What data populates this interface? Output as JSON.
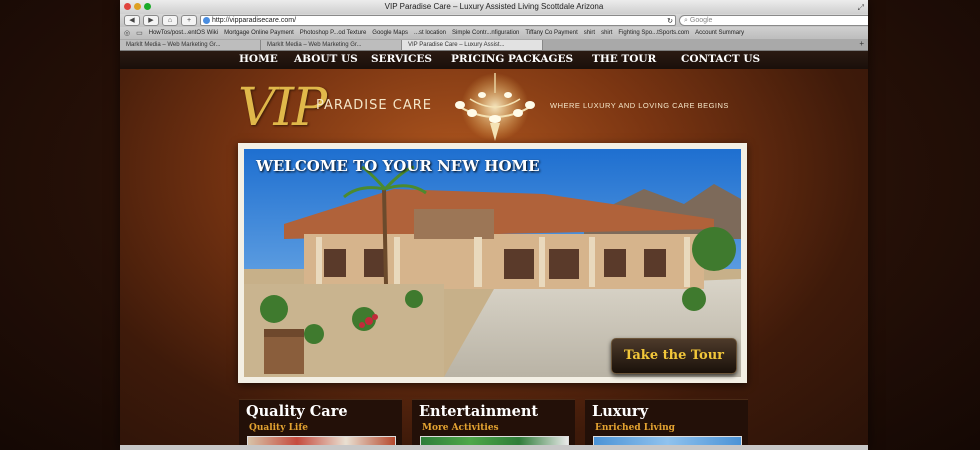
{
  "window": {
    "title": "VIP Paradise Care – Luxury Assisted Living Scottdale Arizona"
  },
  "toolbar": {
    "url": "http://vipparadisecare.com/",
    "search_placeholder": "Google"
  },
  "bookmarks": [
    "HowTos/post...entOS Wiki",
    "Mortgage Online Payment",
    "Photoshop P...od Texture",
    "Google Maps",
    "...st location",
    "Simple Contr...nfiguration",
    "Tiffany Co Payment",
    "shirt",
    "shirt",
    "Fighting Spo...tSports.com",
    "Account Summary"
  ],
  "tabs": [
    "MarkIt Media – Web Marketing Gr...",
    "MarkIt Media – Web Marketing Gr...",
    "VIP Paradise Care – Luxury Assist..."
  ],
  "nav": [
    "HOME",
    "ABOUT US",
    "SERVICES",
    "PRICING PACKAGES",
    "THE TOUR",
    "CONTACT US"
  ],
  "brand": {
    "logo": "VIP",
    "name": "PARADISE CARE",
    "tagline": "WHERE LUXURY AND LOVING CARE BEGINS"
  },
  "hero": {
    "title": "WELCOME TO YOUR NEW HOME",
    "button": "Take the Tour"
  },
  "features": [
    {
      "title": "Quality Care",
      "subtitle": "Quality Life"
    },
    {
      "title": "Entertainment",
      "subtitle": "More Activities"
    },
    {
      "title": "Luxury",
      "subtitle": "Enriched Living"
    }
  ],
  "colors": {
    "accent": "#f2c73a",
    "subtitle": "#e4a331",
    "logo_gold": "#e0b84a"
  },
  "icons": {
    "back": "chevron-left-icon",
    "forward": "chevron-right-icon",
    "home": "home-icon",
    "add": "plus-icon",
    "reload": "reload-icon",
    "settings": "gear-icon"
  }
}
